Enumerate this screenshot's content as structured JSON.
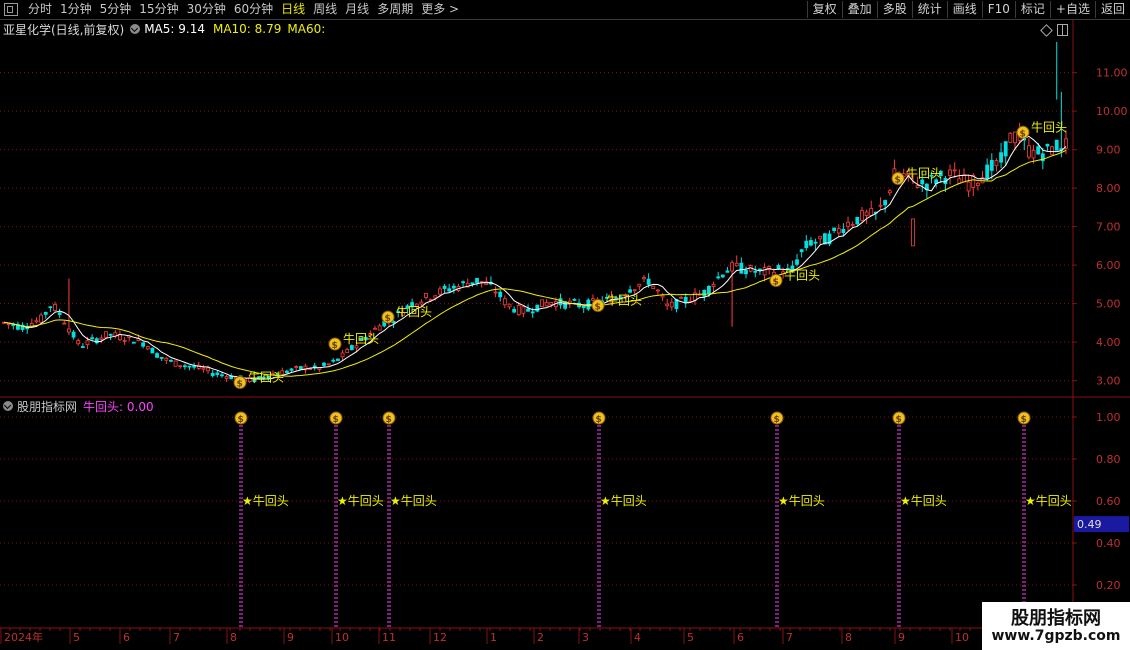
{
  "toolbar": {
    "tabs": [
      "分时",
      "1分钟",
      "5分钟",
      "15分钟",
      "30分钟",
      "60分钟",
      "日线",
      "周线",
      "月线",
      "多周期",
      "更多 >"
    ],
    "active_tab": "日线",
    "buttons": [
      "复权",
      "叠加",
      "多股",
      "统计",
      "画线",
      "F10",
      "标记",
      "+自选",
      "返回"
    ]
  },
  "main_panel": {
    "stock_title": "亚星化学(日线,前复权)",
    "ma5_text": "MA5: 9.14",
    "ma10_text": "MA10: 8.79",
    "ma60_text": "MA60:",
    "price_axis_labels": [
      "11.00",
      "10.00",
      "9.00",
      "8.00",
      "7.00",
      "6.00",
      "5.00",
      "4.00",
      "3.00"
    ],
    "signal_label": "牛回头",
    "colors": {
      "up": "#ff3c3c",
      "down": "#00e0e0",
      "ma5": "#ffffff",
      "ma10": "#f0f000",
      "signal": "#f0f000",
      "grid": "#8a1010"
    }
  },
  "sub_panel": {
    "indicator_name": "股朋指标网",
    "indicator_value": "牛回头: 0.00",
    "axis_labels": [
      "1.00",
      "0.80",
      "0.60",
      "0.40",
      "0.20"
    ],
    "current_value_badge": "0.49",
    "signal_label": "★牛回头",
    "spike_color": "#ff40ff"
  },
  "time_axis": {
    "labels": [
      "2024年",
      "5",
      "6",
      "7",
      "8",
      "9",
      "10",
      "11",
      "12",
      "1",
      "2",
      "3",
      "4",
      "5",
      "6",
      "7",
      "8",
      "9",
      "10"
    ]
  },
  "watermark": {
    "title": "股朋指标网",
    "url": "www.7gpzb.com"
  },
  "chart_data": {
    "type": "candlestick",
    "title": "亚星化学(日线,前复权)",
    "y_axis_range": [
      2.6,
      11.9
    ],
    "series_close": [
      4.5,
      4.45,
      4.4,
      4.5,
      4.6,
      5.0,
      4.7,
      4.3,
      3.9,
      4.0,
      4.1,
      4.2,
      4.15,
      4.1,
      4.05,
      3.95,
      3.7,
      3.55,
      3.45,
      3.4,
      3.35,
      3.3,
      3.2,
      3.15,
      3.1,
      3.05,
      3.0,
      3.05,
      3.15,
      3.2,
      3.25,
      3.3,
      3.35,
      3.3,
      3.4,
      3.5,
      3.7,
      3.9,
      4.1,
      4.3,
      4.5,
      4.6,
      4.8,
      5.0,
      5.1,
      5.2,
      5.3,
      5.4,
      5.45,
      5.55,
      5.6,
      5.5,
      5.3,
      5.0,
      4.85,
      4.8,
      4.9,
      5.0,
      5.05,
      5.0,
      5.0,
      4.95,
      5.0,
      5.05,
      5.1,
      5.2,
      5.4,
      5.5,
      5.6,
      5.3,
      4.9,
      5.0,
      5.1,
      5.2,
      5.3,
      5.6,
      5.85,
      5.95,
      5.9,
      5.85,
      5.8,
      5.85,
      5.9,
      5.8,
      6.3,
      6.6,
      6.6,
      6.7,
      6.9,
      7.1,
      7.2,
      7.3,
      7.3,
      7.7,
      8.4,
      8.3,
      8.2,
      8.1,
      8.2,
      8.3,
      8.35,
      8.2,
      8.1,
      8.3,
      8.5,
      8.6,
      9.3,
      9.35,
      9.0,
      8.9,
      8.95,
      9.1,
      9.14
    ],
    "signals": [
      {
        "label": "牛回头",
        "price": 2.95
      },
      {
        "label": "牛回头",
        "price": 3.95
      },
      {
        "label": "牛回头",
        "price": 4.65
      },
      {
        "label": "牛回头",
        "price": 4.95
      },
      {
        "label": "牛回头",
        "price": 5.6
      },
      {
        "label": "牛回头",
        "price": 8.25
      },
      {
        "label": "牛回头",
        "price": 9.45
      }
    ],
    "sub_indicator": {
      "name": "牛回头",
      "value": 0.0,
      "spike_value": 1.0
    }
  }
}
